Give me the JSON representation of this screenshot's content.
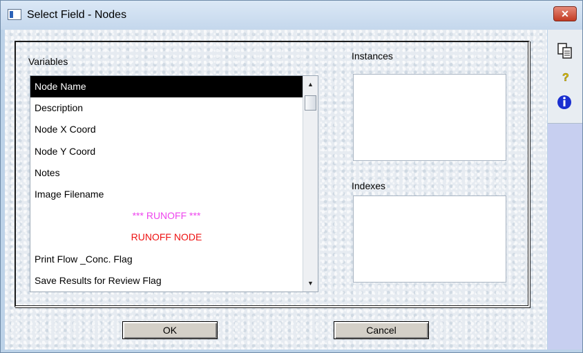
{
  "window": {
    "title": "Select Field - Nodes",
    "close_glyph": "✕"
  },
  "variables": {
    "label": "Variables",
    "items": [
      {
        "text": "Node Name",
        "selected": true,
        "color": "#000000"
      },
      {
        "text": "Description",
        "color": "#000000"
      },
      {
        "text": "Node X Coord",
        "color": "#000000"
      },
      {
        "text": "Node Y Coord",
        "color": "#000000"
      },
      {
        "text": "Notes",
        "color": "#000000"
      },
      {
        "text": "Image Filename",
        "color": "#000000"
      },
      {
        "text": "*** RUNOFF ***",
        "color": "#ee44ee",
        "align": "center"
      },
      {
        "text": "RUNOFF NODE",
        "color": "#ee1111",
        "align": "center"
      },
      {
        "text": "Print Flow _Conc. Flag",
        "color": "#000000"
      },
      {
        "text": "Save Results for Review Flag",
        "color": "#000000"
      }
    ]
  },
  "instances": {
    "label": "Instances"
  },
  "indexes": {
    "label": "Indexes"
  },
  "buttons": {
    "ok": "OK",
    "cancel": "Cancel"
  },
  "side_icons": [
    "copy-icon",
    "help-icon",
    "info-icon"
  ],
  "colors": {
    "selection_bg": "#000000",
    "runoff_header": "#ee44ee",
    "runoff_node": "#ee1111",
    "info_icon": "#1a2fd0",
    "help_icon": "#e0c000"
  }
}
